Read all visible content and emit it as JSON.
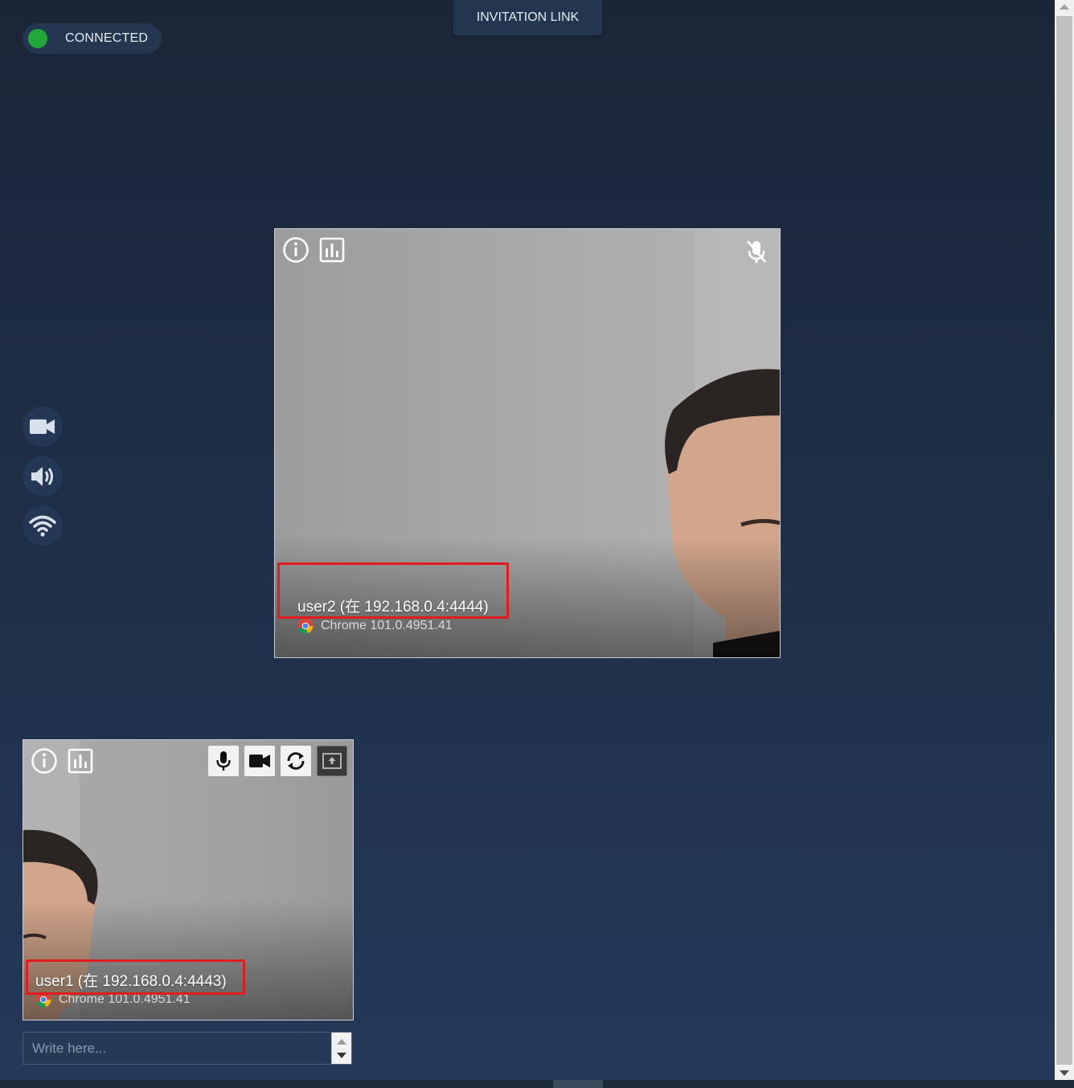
{
  "status": {
    "label": "CONNECTED",
    "dot_color": "#22a83a"
  },
  "header": {
    "invite_label": "INVITATION LINK"
  },
  "side_controls": [
    {
      "name": "camera-toggle-button",
      "icon": "video-camera-icon"
    },
    {
      "name": "speaker-toggle-button",
      "icon": "speaker-volume-icon"
    },
    {
      "name": "network-button",
      "icon": "wifi-icon"
    }
  ],
  "remote_video": {
    "user_label": "user2 (在 192.168.0.4:4444)",
    "browser": "Chrome 101.0.4951.41",
    "muted_icon": "mic-off-icon",
    "top_icons": [
      "info-icon",
      "stats-icon"
    ]
  },
  "local_video": {
    "user_label": "user1 (在 192.168.0.4:4443)",
    "browser": "Chrome 101.0.4951.41",
    "top_icons": [
      "info-icon",
      "stats-icon"
    ],
    "controls": [
      "microphone-icon",
      "video-camera-icon",
      "switch-camera-icon",
      "share-screen-icon"
    ]
  },
  "chat": {
    "placeholder": "Write here..."
  },
  "colors": {
    "highlight": "#e01c1c",
    "panel": "#243650"
  }
}
